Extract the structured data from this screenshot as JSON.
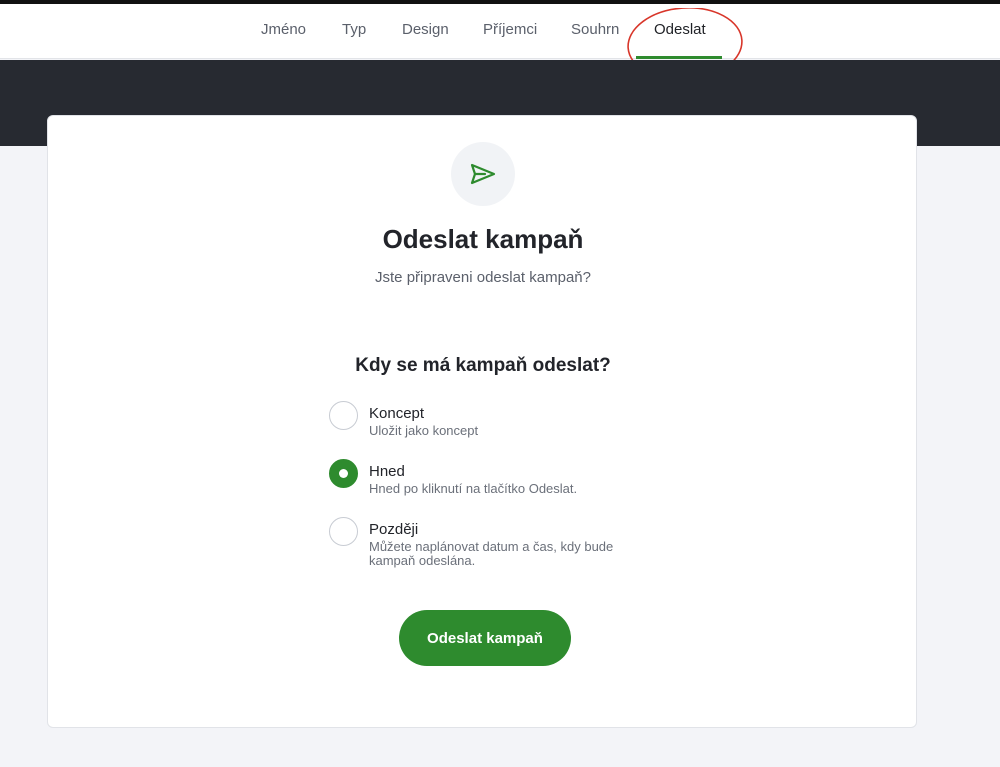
{
  "tabs": [
    {
      "label": "Jméno"
    },
    {
      "label": "Typ"
    },
    {
      "label": "Design"
    },
    {
      "label": "Příjemci"
    },
    {
      "label": "Souhrn"
    },
    {
      "label": "Odeslat",
      "active": true
    }
  ],
  "colors": {
    "accent": "#2e8b2e",
    "dark_band": "#272a31",
    "annotation": "#d8362a",
    "background": "#f3f4f8"
  },
  "card": {
    "icon": "send-icon",
    "title": "Odeslat kampaň",
    "subtitle": "Jste připraveni odeslat kampaň?",
    "question": "Kdy se má kampaň odeslat?",
    "options": [
      {
        "label": "Koncept",
        "description": "Uložit jako koncept",
        "selected": false
      },
      {
        "label": "Hned",
        "description": "Hned po kliknutí na tlačítko Odeslat.",
        "selected": true
      },
      {
        "label": "Později",
        "description": "Můžete naplánovat datum a čas, kdy bude kampaň odeslána.",
        "selected": false
      }
    ],
    "submit_label": "Odeslat kampaň"
  }
}
